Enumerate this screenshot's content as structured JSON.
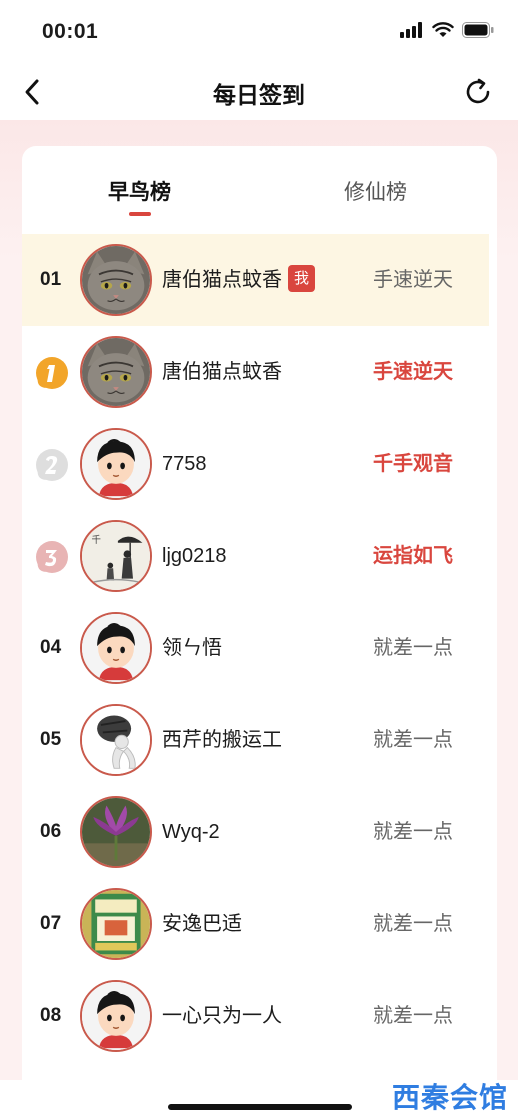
{
  "status_bar": {
    "time": "00:01"
  },
  "nav": {
    "title": "每日签到"
  },
  "tabs": [
    {
      "label": "早鸟榜",
      "active": true
    },
    {
      "label": "修仙榜",
      "active": false
    }
  ],
  "rows": [
    {
      "rank": "01",
      "name": "唐伯猫点蚊香",
      "badge": "我",
      "status": "手速逆天",
      "avatar": "cat-avatar",
      "highlight": true
    },
    {
      "rank": "1",
      "name": "唐伯猫点蚊香",
      "status": "手速逆天",
      "avatar": "cat-avatar",
      "medal": "gold"
    },
    {
      "rank": "2",
      "name": "7758",
      "status": "千手观音",
      "avatar": "cartoon-avatar",
      "medal": "silver"
    },
    {
      "rank": "3",
      "name": "ljg0218",
      "status": "运指如飞",
      "avatar": "ink-painting-avatar",
      "medal": "bronze"
    },
    {
      "rank": "04",
      "name": "领ㄣ悟",
      "status": "就差一点",
      "avatar": "cartoon-avatar"
    },
    {
      "rank": "05",
      "name": "西芹的搬运工",
      "status": "就差一点",
      "avatar": "porter-avatar"
    },
    {
      "rank": "06",
      "name": "Wyq-2",
      "status": "就差一点",
      "avatar": "flower-avatar"
    },
    {
      "rank": "07",
      "name": "安逸巴适",
      "status": "就差一点",
      "avatar": "box-avatar"
    },
    {
      "rank": "08",
      "name": "一心只为一人",
      "status": "就差一点",
      "avatar": "cartoon-avatar"
    }
  ],
  "watermark": "西秦会馆",
  "colors": {
    "accent": "#d9463e",
    "highlight_row": "#fdf6e3",
    "page_bg": "#fdf1f1",
    "avatar_ring": "#c95a4c"
  }
}
